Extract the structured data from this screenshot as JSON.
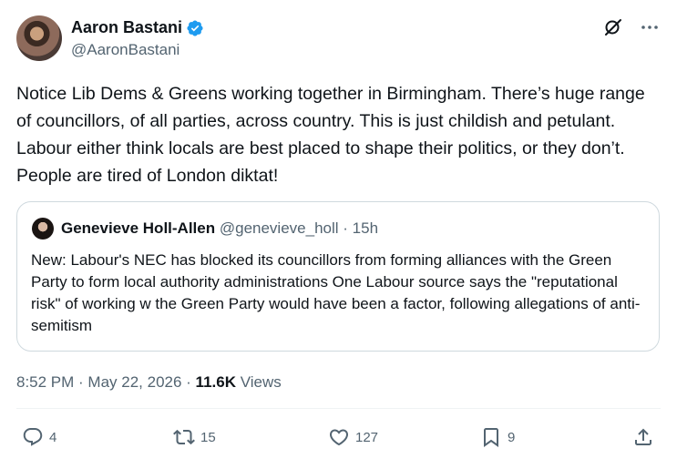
{
  "author": {
    "name": "Aaron Bastani",
    "handle": "@AaronBastani"
  },
  "tweet": {
    "text": "Notice Lib Dems & Greens working together in Birmingham. There’s huge range of councillors, of all parties, across country. This is just childish and petulant. Labour either think locals are best placed to shape their politics, or they don’t. People are tired of London diktat!"
  },
  "quote": {
    "name": "Genevieve Holl-Allen",
    "handle": "@genevieve_holl",
    "separator": " · ",
    "time": "15h",
    "text": "New: Labour's NEC has blocked its councillors from forming alliances with the Green Party to form local authority administrations One Labour source says the \"reputational risk\" of working w the Green Party would have been a factor, following allegations of anti-semitism"
  },
  "meta": {
    "time": "8:52 PM",
    "sep1": " · ",
    "date": "May 22, 2026",
    "sep2": " · ",
    "views_count": "11.6K",
    "views_label": " Views"
  },
  "actions": {
    "replies": "4",
    "reposts": "15",
    "likes": "127",
    "bookmarks": "9"
  },
  "colors": {
    "verified": "#1d9bf0",
    "muted": "#536471",
    "text": "#0f1419",
    "border": "#cfd9de"
  },
  "icons": [
    "verified-badge-icon",
    "grok-icon",
    "more-icon",
    "reply-icon",
    "repost-icon",
    "like-icon",
    "bookmark-icon",
    "share-icon"
  ]
}
